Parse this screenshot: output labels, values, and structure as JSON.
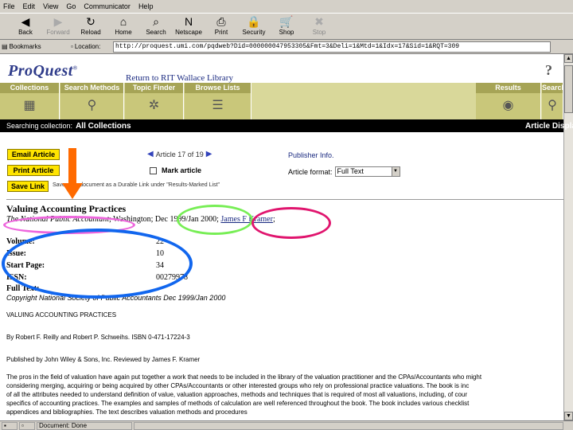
{
  "menu": [
    "File",
    "Edit",
    "View",
    "Go",
    "Communicator",
    "Help"
  ],
  "toolbar": [
    {
      "label": "Back",
      "icon": "back-arrow-icon",
      "glyph": "◀",
      "enabled": true
    },
    {
      "label": "Forward",
      "icon": "forward-arrow-icon",
      "glyph": "▶",
      "enabled": false
    },
    {
      "label": "Reload",
      "icon": "reload-icon",
      "glyph": "↻",
      "enabled": true
    },
    {
      "label": "Home",
      "icon": "home-icon",
      "glyph": "⌂",
      "enabled": true
    },
    {
      "label": "Search",
      "icon": "search-icon",
      "glyph": "⌕",
      "enabled": true
    },
    {
      "label": "Netscape",
      "icon": "netscape-icon",
      "glyph": "N",
      "enabled": true
    },
    {
      "label": "Print",
      "icon": "print-icon",
      "glyph": "⎙",
      "enabled": true
    },
    {
      "label": "Security",
      "icon": "security-lock-icon",
      "glyph": "🔒",
      "enabled": true
    },
    {
      "label": "Shop",
      "icon": "shop-icon",
      "glyph": "🛒",
      "enabled": true
    },
    {
      "label": "Stop",
      "icon": "stop-icon",
      "glyph": "✖",
      "enabled": false
    }
  ],
  "location": {
    "bookmarks_label": "Bookmarks",
    "location_label": "Location:",
    "url": "http://proquest.umi.com/pqdweb?Did=000000047953305&Fmt=3&Deli=1&Mtd=1&Idx=17&Sid=1&RQT=309"
  },
  "proquest": {
    "logo": "ProQuest",
    "logo_mark": "®",
    "return_link": "Return to RIT Wallace Library",
    "help": "?"
  },
  "nav_tabs": [
    {
      "label": "Collections",
      "icon": "collections-icon",
      "glyph": "▦"
    },
    {
      "label": "Search Methods",
      "icon": "search-methods-icon",
      "glyph": "⚲"
    },
    {
      "label": "Topic Finder",
      "icon": "topic-finder-icon",
      "glyph": "✲"
    },
    {
      "label": "Browse Lists",
      "icon": "browse-lists-icon",
      "glyph": "☰"
    }
  ],
  "nav_right": [
    {
      "label": "Results",
      "icon": "results-icon",
      "glyph": "◉"
    },
    {
      "label": "Search",
      "icon": "search-tab-icon",
      "glyph": "⚲"
    }
  ],
  "context_bar": {
    "label": "Searching collection:",
    "value": "All Collections",
    "right": "Article Display"
  },
  "actions": {
    "email": "Email Article",
    "print": "Print Article",
    "save_link": "Save Link",
    "save_info": "Saves this document as a Durable Link under \"Results-Marked List\""
  },
  "pager": {
    "prev": "◀",
    "text": "Article 17 of 19",
    "next": "▶"
  },
  "mark_article": "Mark article",
  "publisher_info": "Publisher Info.",
  "format": {
    "label": "Article format:",
    "value": "Full Text"
  },
  "article": {
    "title": "Valuing Accounting Practices",
    "publication": "The National Public Accountant",
    "place": "; Washington;",
    "date": "Dec 1999/Jan 2000",
    "sep": ";",
    "author": "James F Kramer",
    "end": ";",
    "fields": [
      {
        "label": "Volume:",
        "value": "22"
      },
      {
        "label": "Issue:",
        "value": "10"
      },
      {
        "label": "Start Page:",
        "value": "34"
      },
      {
        "label": "ISSN:",
        "value": "00279978"
      },
      {
        "label": "Full Text:",
        "value": ""
      }
    ],
    "copyright": "Copyright National Society of Public Accountants Dec 1999/Jan 2000",
    "body": [
      "VALUING ACCOUNTING PRACTICES",
      "By Robert F. Reilly and Robert P. Schweihs. ISBN 0-471-17224-3",
      "Published by John Wiley & Sons, Inc. Reviewed by James F. Kramer",
      "The pros in the field of valuation have again put together a work that needs to be included in the library of the valuation practitioner and the CPAs/Accountants who might",
      "considering merging, acquiring or being acquired by other CPAs/Accountants or other interested groups who rely on professional practice valuations. The book is inc",
      "of all the attributes needed to understand definition of value, valuation approaches, methods and techniques that is required of most all valuations, including, of cour",
      "specifics of accounting practices. The examples and samples of methods of calculation are well referenced throughout the book. The book includes various checklist",
      "appendices and bibliographies. The text describes valuation methods and procedures"
    ]
  },
  "status": {
    "text": "Document: Done"
  },
  "annotation_colors": {
    "pink": "#ee66dd",
    "green": "#77ee55",
    "magenta": "#e0156e",
    "blue": "#1166ee",
    "arrow": "#ff6a00"
  }
}
